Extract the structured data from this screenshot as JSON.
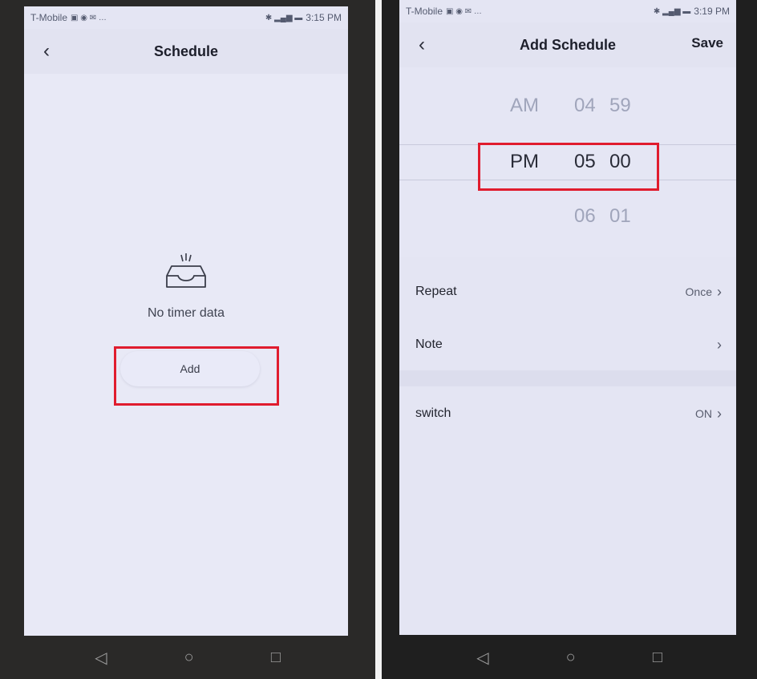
{
  "left": {
    "status": {
      "carrier": "T-Mobile",
      "time": "3:15 PM"
    },
    "nav": {
      "title": "Schedule",
      "back_icon": "chevron-left-icon"
    },
    "empty": {
      "icon": "empty-inbox-icon",
      "text": "No timer data"
    },
    "add_label": "Add"
  },
  "right": {
    "status": {
      "carrier": "T-Mobile",
      "time": "3:19 PM"
    },
    "nav": {
      "title": "Add Schedule",
      "save_label": "Save",
      "back_icon": "chevron-left-icon"
    },
    "picker": {
      "above": {
        "ampm": "AM",
        "hour": "04",
        "minute": "59"
      },
      "selected": {
        "ampm": "PM",
        "hour": "05",
        "minute": "00"
      },
      "below": {
        "hour": "06",
        "minute": "01"
      }
    },
    "settings": {
      "repeat": {
        "label": "Repeat",
        "value": "Once"
      },
      "note": {
        "label": "Note",
        "value": ""
      },
      "switch": {
        "label": "switch",
        "value": "ON"
      }
    }
  },
  "colors": {
    "highlight": "#e01c2e",
    "screen_bg": "#e4e5f3"
  },
  "softkeys": {
    "back": "◁",
    "home": "○",
    "recent": "□"
  }
}
